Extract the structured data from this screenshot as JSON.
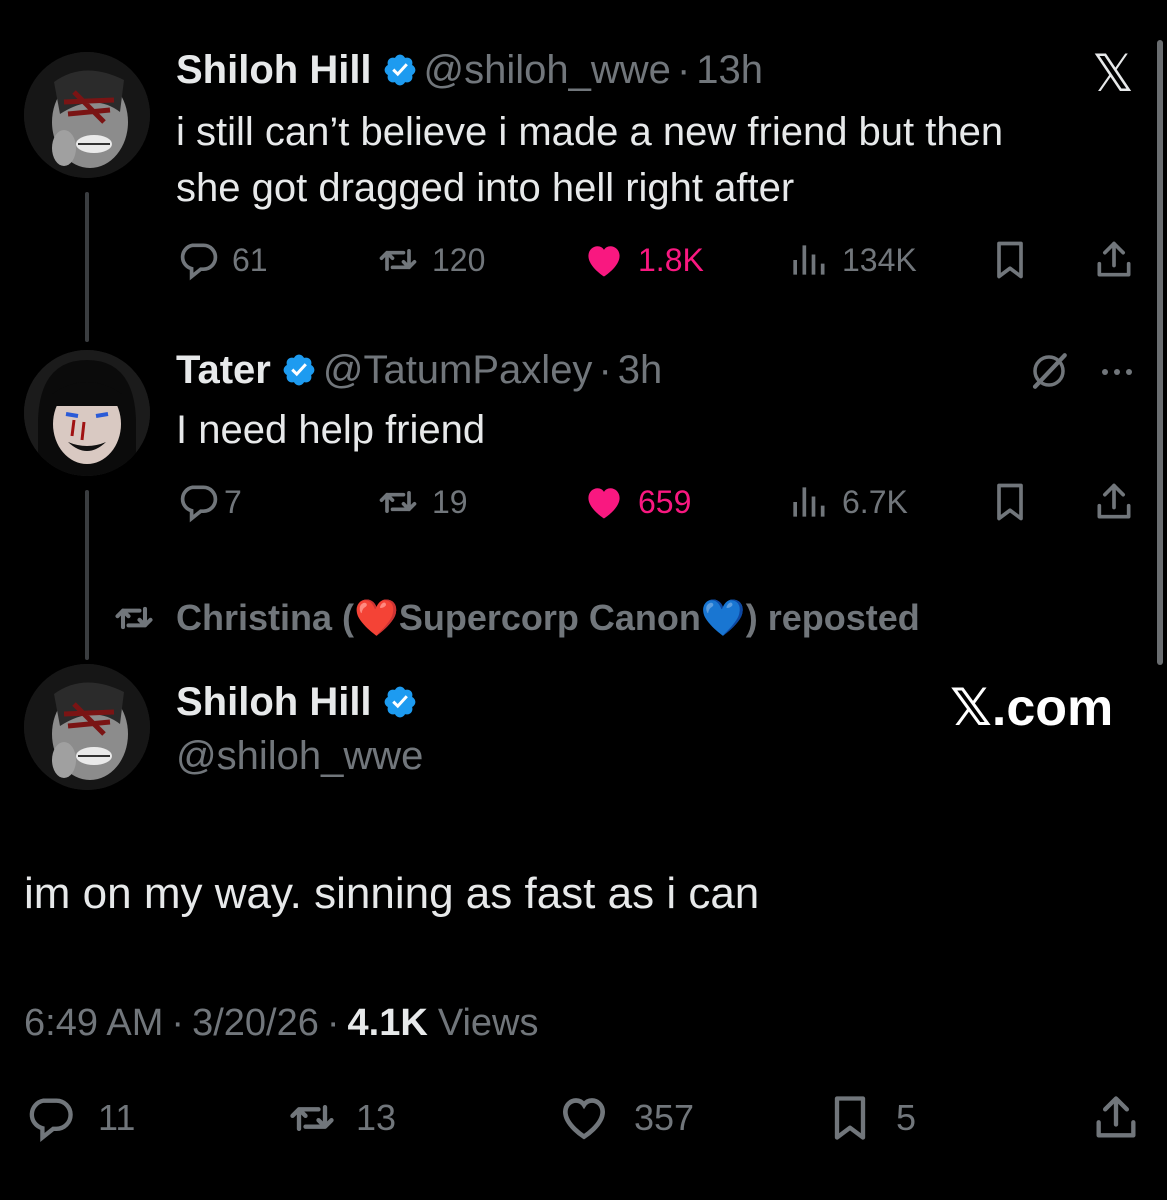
{
  "thread": [
    {
      "name": "Shiloh Hill",
      "handle": "@shiloh_wwe",
      "time": "13h",
      "text_line1": "i still can’t believe i made a new friend but then",
      "text_line2": "she got dragged into hell right after",
      "replies": "61",
      "reposts": "120",
      "likes": "1.8K",
      "views": "134K"
    },
    {
      "name": "Tater",
      "handle": "@TatumPaxley",
      "time": "3h",
      "text": "I need help friend",
      "replies": "7",
      "reposts": "19",
      "likes": "659",
      "views": "6.7K"
    }
  ],
  "repost_banner": {
    "prefix": "Christina (",
    "middle": "Supercorp Canon",
    "suffix": ") reposted",
    "heart1": "❤️",
    "heart2": "💙"
  },
  "main_tweet": {
    "name": "Shiloh Hill",
    "handle": "@shiloh_wwe",
    "text": "im on my way. sinning as fast as i can",
    "time": "6:49 AM",
    "date": "3/20/26",
    "views_count": "4.1K",
    "views_label": "Views",
    "replies": "11",
    "reposts": "13",
    "likes": "357",
    "bookmarks": "5"
  },
  "brand": {
    "logo": "𝕏",
    "watermark": "𝕏.com"
  },
  "colors": {
    "background": "#000000",
    "text": "#e7e9ea",
    "muted": "#71767b",
    "like_pink": "#f91880",
    "verified_blue": "#1d9bf0"
  },
  "icons": [
    "reply-icon",
    "repost-icon",
    "heart-icon",
    "views-icon",
    "bookmark-icon",
    "share-icon",
    "grok-icon",
    "more-icon",
    "verified-icon",
    "x-logo-icon"
  ]
}
